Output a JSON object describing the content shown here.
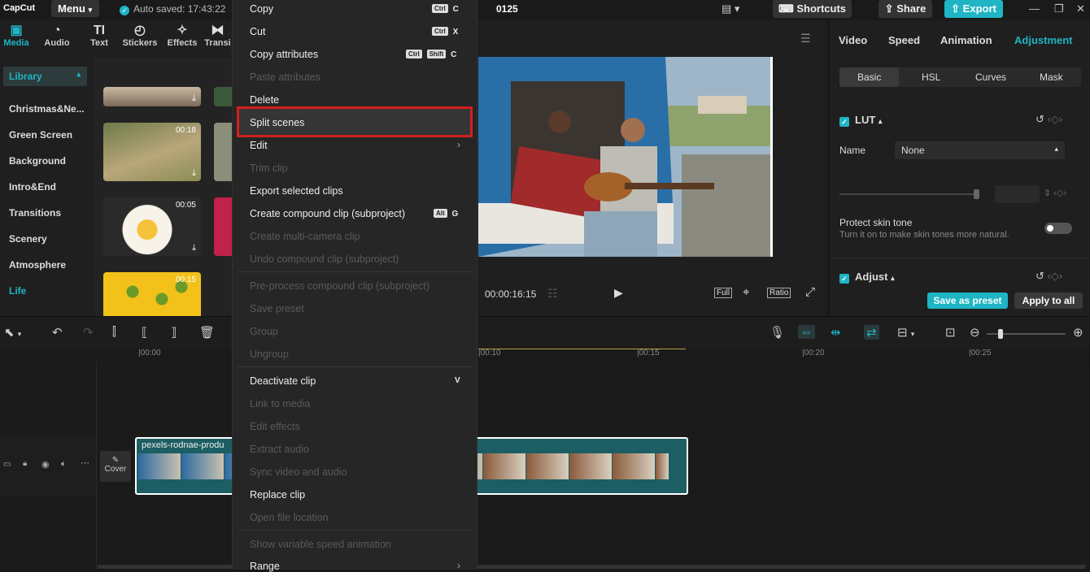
{
  "titlebar": {
    "logo": "CapCut",
    "menu_label": "Menu",
    "autosave": "Auto saved: 17:43:22",
    "project_name": "0125",
    "shortcuts": "Shortcuts",
    "share": "Share",
    "export": "Export"
  },
  "toolbar": {
    "items": [
      {
        "label": "Media",
        "icon": "media-icon"
      },
      {
        "label": "Audio",
        "icon": "audio-icon"
      },
      {
        "label": "Text",
        "icon": "text-icon"
      },
      {
        "label": "Stickers",
        "icon": "stickers-icon"
      },
      {
        "label": "Effects",
        "icon": "effects-icon"
      },
      {
        "label": "Transi",
        "icon": "transitions-icon"
      }
    ]
  },
  "leftnav": {
    "library": "Library",
    "items": [
      "Christmas&Ne...",
      "Green Screen",
      "Background",
      "Intro&End",
      "Transitions",
      "Scenery",
      "Atmosphere",
      "Life"
    ]
  },
  "thumbs": {
    "durations": [
      "00:18",
      "00:05",
      "00:15"
    ]
  },
  "context_menu": {
    "items": [
      {
        "label": "Copy",
        "shortcut_keys": [
          "Ctrl"
        ],
        "shortcut": "C",
        "disabled": false
      },
      {
        "label": "Cut",
        "shortcut_keys": [
          "Ctrl"
        ],
        "shortcut": "X",
        "disabled": false
      },
      {
        "label": "Copy attributes",
        "shortcut_keys": [
          "Ctrl",
          "Shift"
        ],
        "shortcut": "C",
        "disabled": false
      },
      {
        "label": "Paste attributes",
        "disabled": true
      },
      {
        "label": "Delete",
        "disabled": false
      },
      {
        "label": "Split scenes",
        "disabled": false,
        "highlighted": true
      },
      {
        "label": "Edit",
        "disabled": false,
        "submenu": true
      },
      {
        "label": "Trim clip",
        "disabled": true
      },
      {
        "label": "Export selected clips",
        "disabled": false
      },
      {
        "label": "Create compound clip (subproject)",
        "shortcut_keys": [
          "Alt"
        ],
        "shortcut": "G",
        "disabled": false
      },
      {
        "label": "Create multi-camera clip",
        "disabled": true
      },
      {
        "label": "Undo compound clip (subproject)",
        "disabled": true
      },
      {
        "label": "Pre-process compound clip (subproject)",
        "disabled": true
      },
      {
        "label": "Save preset",
        "disabled": true
      },
      {
        "label": "Group",
        "disabled": true
      },
      {
        "label": "Ungroup",
        "disabled": true
      },
      {
        "label": "Deactivate clip",
        "shortcut": "V",
        "disabled": false
      },
      {
        "label": "Link to media",
        "disabled": true
      },
      {
        "label": "Edit effects",
        "disabled": true
      },
      {
        "label": "Extract audio",
        "disabled": true
      },
      {
        "label": "Sync video and audio",
        "disabled": true
      },
      {
        "label": "Replace clip",
        "disabled": false
      },
      {
        "label": "Open file location",
        "disabled": true
      },
      {
        "label": "Show variable speed animation",
        "disabled": true
      },
      {
        "label": "Range",
        "disabled": false,
        "submenu": true
      }
    ]
  },
  "preview": {
    "timecode": "00:00:16:15",
    "full": "Full",
    "ratio": "Ratio"
  },
  "right_panel": {
    "tabs": [
      "Video",
      "Speed",
      "Animation",
      "Adjustment"
    ],
    "active_tab": "Adjustment",
    "subtabs": [
      "Basic",
      "HSL",
      "Curves",
      "Mask"
    ],
    "active_subtab": "Basic",
    "lut_label": "LUT",
    "name_label": "Name",
    "name_value": "None",
    "protect_title": "Protect skin tone",
    "protect_desc": "Turn it on to make skin tones more natural.",
    "adjust_label": "Adjust",
    "save_preset": "Save as preset",
    "apply_all": "Apply to all"
  },
  "timeline": {
    "ruler": [
      "|00:00",
      "|00:10",
      "|00:15",
      "|00:20",
      "|00:25"
    ],
    "cover_label": "Cover",
    "clip_name": "pexels-rodnae-produ"
  },
  "colors": {
    "accent": "#1fb5c4",
    "highlight_border": "#d21f1f",
    "clip_bg": "#1c5e63"
  }
}
